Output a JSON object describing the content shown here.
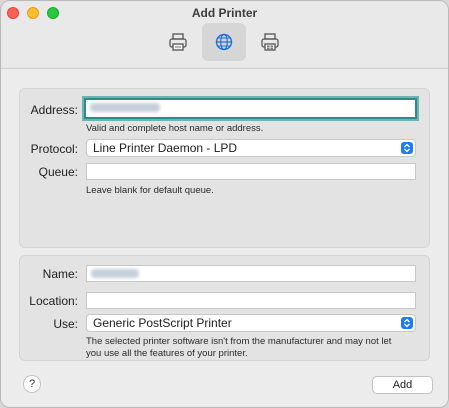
{
  "window": {
    "title": "Add Printer"
  },
  "toolbar": {
    "items": [
      {
        "icon": "printer-icon",
        "name": "Default"
      },
      {
        "icon": "globe-icon",
        "name": "IP",
        "active": true
      },
      {
        "icon": "windows-printer-icon",
        "name": "Windows"
      }
    ]
  },
  "address_section": {
    "address_label": "Address:",
    "address_hint": "Valid and complete host name or address.",
    "protocol_label": "Protocol:",
    "protocol_value": "Line Printer Daemon - LPD",
    "queue_label": "Queue:",
    "queue_value": "",
    "queue_hint": "Leave blank for default queue."
  },
  "details_section": {
    "name_label": "Name:",
    "location_label": "Location:",
    "location_value": "",
    "use_label": "Use:",
    "use_value": "Generic PostScript Printer",
    "use_hint_line1": "The selected printer software isn't from the manufacturer and may not let",
    "use_hint_line2": "you use all the features of your printer."
  },
  "footer": {
    "help_label": "?",
    "add_label": "Add"
  },
  "colors": {
    "focus_ring": "#2b8c8a",
    "popup_chevron": "#1e7bf2"
  }
}
